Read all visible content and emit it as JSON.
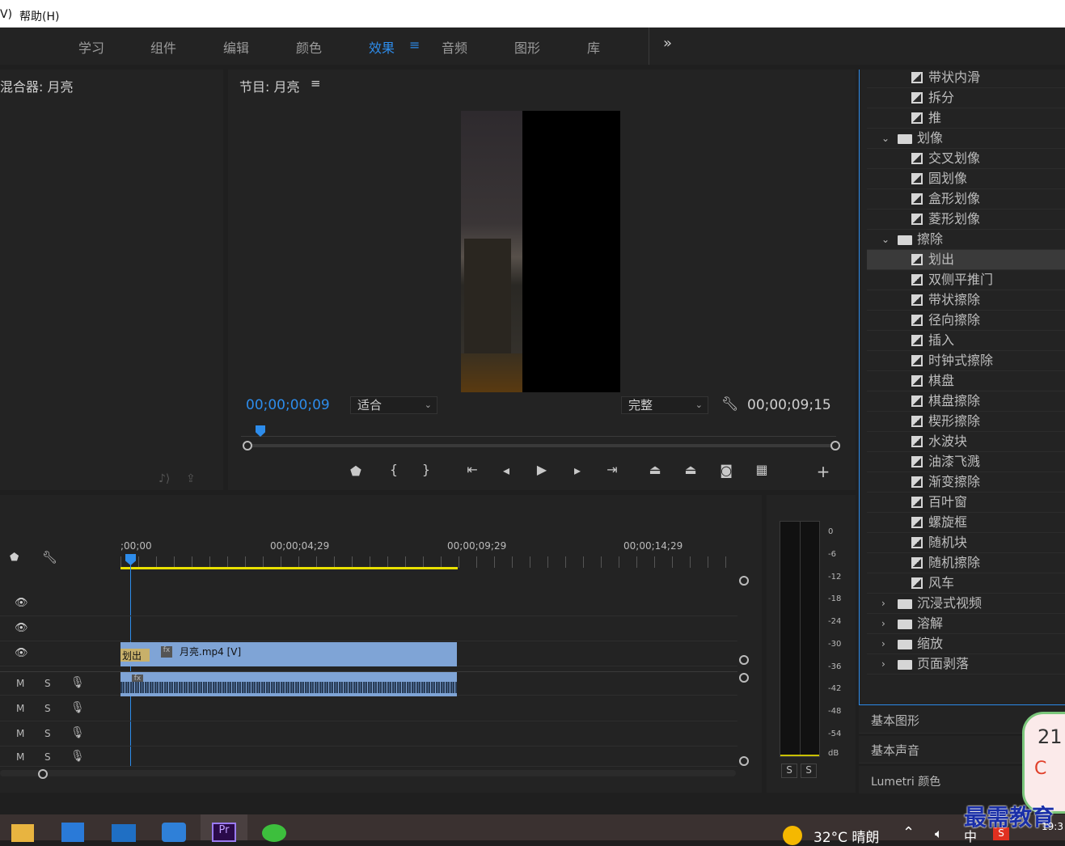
{
  "menubar": {
    "item_left": "V)",
    "help": "帮助(H)"
  },
  "workspaces": [
    {
      "label": "学习",
      "active": false
    },
    {
      "label": "组件",
      "active": false
    },
    {
      "label": "编辑",
      "active": false
    },
    {
      "label": "颜色",
      "active": false
    },
    {
      "label": "效果",
      "active": true
    },
    {
      "label": "音频",
      "active": false
    },
    {
      "label": "图形",
      "active": false
    },
    {
      "label": "库",
      "active": false
    }
  ],
  "workspace_menu_icon": "≡",
  "workspace_more": "»",
  "source_panel": {
    "title": "混合器: 月亮"
  },
  "program_monitor": {
    "title": "节目: 月亮",
    "menu_icon": "≡",
    "timecode_current": "00;00;00;09",
    "fit_select": "适合",
    "quality_select": "完整",
    "timecode_duration": "00;00;09;15"
  },
  "timeline": {
    "ruler_labels": [
      ";00;00",
      "00;00;04;29",
      "00;00;09;29",
      "00;00;14;29"
    ],
    "video_clip_label": "月亮.mp4 [V]",
    "transition_label": "划出",
    "fx_badge": "fx",
    "track_M": "M",
    "track_S": "S"
  },
  "audio_meter": {
    "scale": [
      "0",
      "-6",
      "-12",
      "-18",
      "-24",
      "-30",
      "-36",
      "-42",
      "-48",
      "-54",
      "dB"
    ],
    "solo_left": "S",
    "solo_right": "S"
  },
  "effects": [
    {
      "type": "item",
      "label": "带状内滑",
      "indent": 2
    },
    {
      "type": "item",
      "label": "拆分",
      "indent": 2
    },
    {
      "type": "item",
      "label": "推",
      "indent": 2
    },
    {
      "type": "folder",
      "label": "划像",
      "open": true,
      "indent": 1
    },
    {
      "type": "item",
      "label": "交叉划像",
      "indent": 2
    },
    {
      "type": "item",
      "label": "圆划像",
      "indent": 2
    },
    {
      "type": "item",
      "label": "盒形划像",
      "indent": 2
    },
    {
      "type": "item",
      "label": "菱形划像",
      "indent": 2
    },
    {
      "type": "folder",
      "label": "擦除",
      "open": true,
      "indent": 1
    },
    {
      "type": "item",
      "label": "划出",
      "indent": 2,
      "selected": true
    },
    {
      "type": "item",
      "label": "双侧平推门",
      "indent": 2
    },
    {
      "type": "item",
      "label": "带状擦除",
      "indent": 2
    },
    {
      "type": "item",
      "label": "径向擦除",
      "indent": 2
    },
    {
      "type": "item",
      "label": "插入",
      "indent": 2
    },
    {
      "type": "item",
      "label": "时钟式擦除",
      "indent": 2
    },
    {
      "type": "item",
      "label": "棋盘",
      "indent": 2
    },
    {
      "type": "item",
      "label": "棋盘擦除",
      "indent": 2
    },
    {
      "type": "item",
      "label": "楔形擦除",
      "indent": 2
    },
    {
      "type": "item",
      "label": "水波块",
      "indent": 2
    },
    {
      "type": "item",
      "label": "油漆飞溅",
      "indent": 2
    },
    {
      "type": "item",
      "label": "渐变擦除",
      "indent": 2
    },
    {
      "type": "item",
      "label": "百叶窗",
      "indent": 2
    },
    {
      "type": "item",
      "label": "螺旋框",
      "indent": 2
    },
    {
      "type": "item",
      "label": "随机块",
      "indent": 2
    },
    {
      "type": "item",
      "label": "随机擦除",
      "indent": 2
    },
    {
      "type": "item",
      "label": "风车",
      "indent": 2
    },
    {
      "type": "folder",
      "label": "沉浸式视频",
      "open": false,
      "indent": 1
    },
    {
      "type": "folder",
      "label": "溶解",
      "open": false,
      "indent": 1
    },
    {
      "type": "folder",
      "label": "缩放",
      "open": false,
      "indent": 1
    },
    {
      "type": "folder",
      "label": "页面剥落",
      "open": false,
      "indent": 1
    }
  ],
  "side_panels": [
    "基本图形",
    "基本声音",
    "Lumetri 颜色"
  ],
  "taskbar": {
    "temperature": "32°C 晴朗",
    "ime": "中",
    "watermark": "最需教育",
    "badge_number": "21",
    "clock_fragment": "19:3"
  },
  "colors": {
    "accent": "#2d8ceb",
    "video_clip": "#7fa4d6",
    "audio_clip": "#7fa4d6",
    "work_area": "#e8e000",
    "selection": "#3a3a3a"
  }
}
